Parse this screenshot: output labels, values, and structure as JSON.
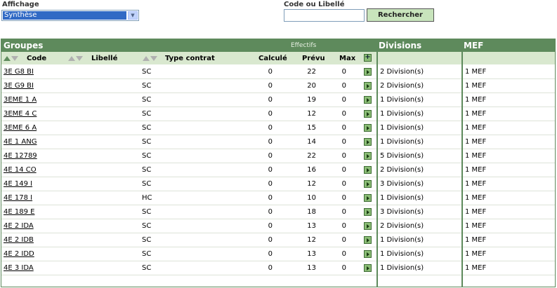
{
  "affichage": {
    "label": "Affichage",
    "selected": "Synthèse"
  },
  "search": {
    "label": "Code ou Libellé",
    "value": "",
    "button": "Rechercher"
  },
  "table": {
    "header": {
      "groupes": "Groupes",
      "effectifs": "Effectifs",
      "divisions": "Divisions",
      "mef": "MEF"
    },
    "columns": {
      "code": "Code",
      "libelle": "Libellé",
      "type": "Type contrat",
      "calcule": "Calculé",
      "prevu": "Prévu",
      "max": "Max",
      "plus": "+"
    },
    "rows": [
      {
        "code": "3E G8 BI",
        "libelle": "",
        "type": "SC",
        "calcule": "0",
        "prevu": "22",
        "max": "0",
        "divisions": "2 Division(s)",
        "mef": "1 MEF"
      },
      {
        "code": "3E G9 BI",
        "libelle": "",
        "type": "SC",
        "calcule": "0",
        "prevu": "20",
        "max": "0",
        "divisions": "2 Division(s)",
        "mef": "1 MEF"
      },
      {
        "code": "3EME 1 A",
        "libelle": "",
        "type": "SC",
        "calcule": "0",
        "prevu": "19",
        "max": "0",
        "divisions": "1 Division(s)",
        "mef": "1 MEF"
      },
      {
        "code": "3EME 4 C",
        "libelle": "",
        "type": "SC",
        "calcule": "0",
        "prevu": "12",
        "max": "0",
        "divisions": "1 Division(s)",
        "mef": "1 MEF"
      },
      {
        "code": "3EME 6 A",
        "libelle": "",
        "type": "SC",
        "calcule": "0",
        "prevu": "15",
        "max": "0",
        "divisions": "1 Division(s)",
        "mef": "1 MEF"
      },
      {
        "code": "4E 1 ANG",
        "libelle": "",
        "type": "SC",
        "calcule": "0",
        "prevu": "14",
        "max": "0",
        "divisions": "1 Division(s)",
        "mef": "1 MEF"
      },
      {
        "code": "4E 12789",
        "libelle": "",
        "type": "SC",
        "calcule": "0",
        "prevu": "22",
        "max": "0",
        "divisions": "5 Division(s)",
        "mef": "1 MEF"
      },
      {
        "code": "4E 14 CO",
        "libelle": "",
        "type": "SC",
        "calcule": "0",
        "prevu": "16",
        "max": "0",
        "divisions": "2 Division(s)",
        "mef": "1 MEF"
      },
      {
        "code": "4E 149 I",
        "libelle": "",
        "type": "SC",
        "calcule": "0",
        "prevu": "12",
        "max": "0",
        "divisions": "3 Division(s)",
        "mef": "1 MEF"
      },
      {
        "code": "4E 178 I",
        "libelle": "",
        "type": "HC",
        "calcule": "0",
        "prevu": "10",
        "max": "0",
        "divisions": "1 Division(s)",
        "mef": "1 MEF"
      },
      {
        "code": "4E 189 E",
        "libelle": "",
        "type": "SC",
        "calcule": "0",
        "prevu": "18",
        "max": "0",
        "divisions": "3 Division(s)",
        "mef": "1 MEF"
      },
      {
        "code": "4E 2 IDA",
        "libelle": "",
        "type": "SC",
        "calcule": "0",
        "prevu": "13",
        "max": "0",
        "divisions": "2 Division(s)",
        "mef": "1 MEF"
      },
      {
        "code": "4E 2 IDB",
        "libelle": "",
        "type": "SC",
        "calcule": "0",
        "prevu": "12",
        "max": "0",
        "divisions": "1 Division(s)",
        "mef": "1 MEF"
      },
      {
        "code": "4E 2 IDD",
        "libelle": "",
        "type": "SC",
        "calcule": "0",
        "prevu": "13",
        "max": "0",
        "divisions": "1 Division(s)",
        "mef": "1 MEF"
      },
      {
        "code": "4E 3 IDA",
        "libelle": "",
        "type": "SC",
        "calcule": "0",
        "prevu": "13",
        "max": "0",
        "divisions": "1 Division(s)",
        "mef": "1 MEF"
      }
    ]
  },
  "colors": {
    "header": "#5e8a5c",
    "subheader": "#d9e8cf",
    "button": "#c8e4bc"
  },
  "icons": {
    "sort_asc": "sort-asc-icon",
    "sort_desc": "sort-desc-icon",
    "go": "arrow-right-icon"
  }
}
